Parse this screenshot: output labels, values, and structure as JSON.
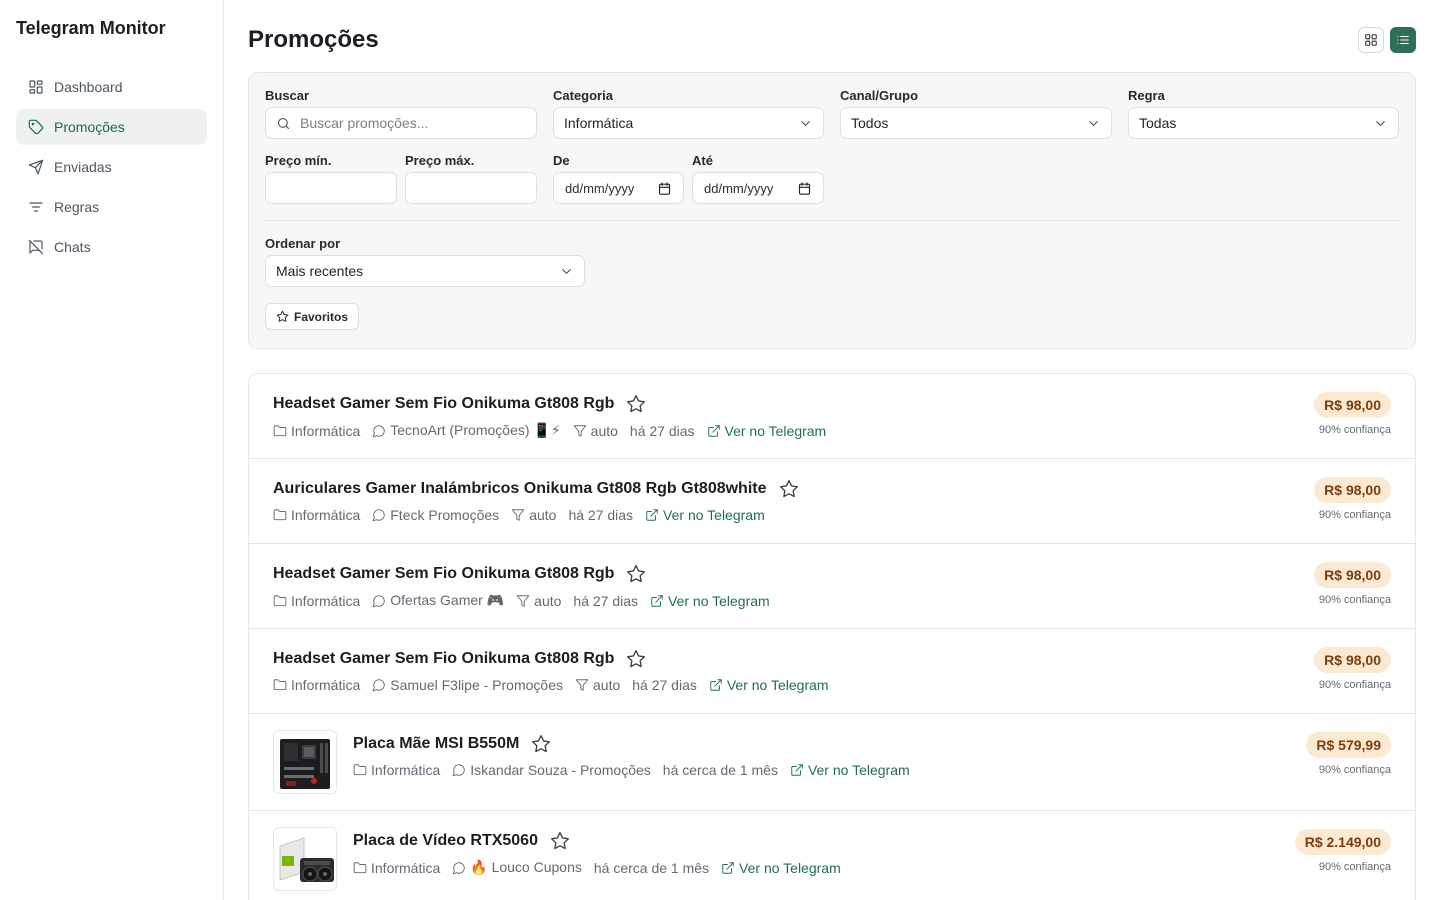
{
  "app": {
    "title": "Telegram Monitor"
  },
  "sidebar": {
    "items": [
      {
        "label": "Dashboard",
        "icon": "dashboard-icon"
      },
      {
        "label": "Promoções",
        "icon": "tag-icon",
        "active": true
      },
      {
        "label": "Enviadas",
        "icon": "send-icon"
      },
      {
        "label": "Regras",
        "icon": "filter-lines-icon"
      },
      {
        "label": "Chats",
        "icon": "message-off-icon"
      }
    ]
  },
  "page": {
    "title": "Promoções"
  },
  "filters": {
    "search": {
      "label": "Buscar",
      "placeholder": "Buscar promoções..."
    },
    "category": {
      "label": "Categoria",
      "value": "Informática"
    },
    "channel": {
      "label": "Canal/Grupo",
      "value": "Todos"
    },
    "rule": {
      "label": "Regra",
      "value": "Todas"
    },
    "price_min": {
      "label": "Preço mín.",
      "value": ""
    },
    "price_max": {
      "label": "Preço máx.",
      "value": ""
    },
    "date_from": {
      "label": "De",
      "value": "dd/mm/yyyy"
    },
    "date_to": {
      "label": "Até",
      "value": "dd/mm/yyyy"
    },
    "sort": {
      "label": "Ordenar por",
      "value": "Mais recentes"
    },
    "favorites_label": "Favoritos"
  },
  "promotions": [
    {
      "title": "Headset Gamer Sem Fio Onikuma Gt808 Rgb",
      "category": "Informática",
      "channel": "TecnoArt (Promoções) 📱⚡",
      "rule": "auto",
      "time": "há 27 dias",
      "link": "Ver no Telegram",
      "price": "R$ 98,00",
      "confidence": "90% confiança"
    },
    {
      "title": "Auriculares Gamer Inalámbricos Onikuma Gt808 Rgb Gt808white",
      "category": "Informática",
      "channel": "Fteck Promoções",
      "rule": "auto",
      "time": "há 27 dias",
      "link": "Ver no Telegram",
      "price": "R$ 98,00",
      "confidence": "90% confiança"
    },
    {
      "title": "Headset Gamer Sem Fio Onikuma Gt808 Rgb",
      "category": "Informática",
      "channel": "Ofertas Gamer 🎮",
      "rule": "auto",
      "time": "há 27 dias",
      "link": "Ver no Telegram",
      "price": "R$ 98,00",
      "confidence": "90% confiança"
    },
    {
      "title": "Headset Gamer Sem Fio Onikuma Gt808 Rgb",
      "category": "Informática",
      "channel": "Samuel F3lipe - Promoções",
      "rule": "auto",
      "time": "há 27 dias",
      "link": "Ver no Telegram",
      "price": "R$ 98,00",
      "confidence": "90% confiança"
    },
    {
      "title": "Placa Mãe MSI B550M",
      "category": "Informática",
      "channel": "Iskandar Souza - Promoções",
      "time": "há cerca de 1 mês",
      "link": "Ver no Telegram",
      "price": "R$ 579,99",
      "confidence": "90% confiança"
    },
    {
      "title": "Placa de Vídeo RTX5060",
      "category": "Informática",
      "channel": "🔥 Louco Cupons",
      "time": "há cerca de 1 mês",
      "link": "Ver no Telegram",
      "price": "R$ 2.149,00",
      "confidence": "90% confiança"
    }
  ]
}
